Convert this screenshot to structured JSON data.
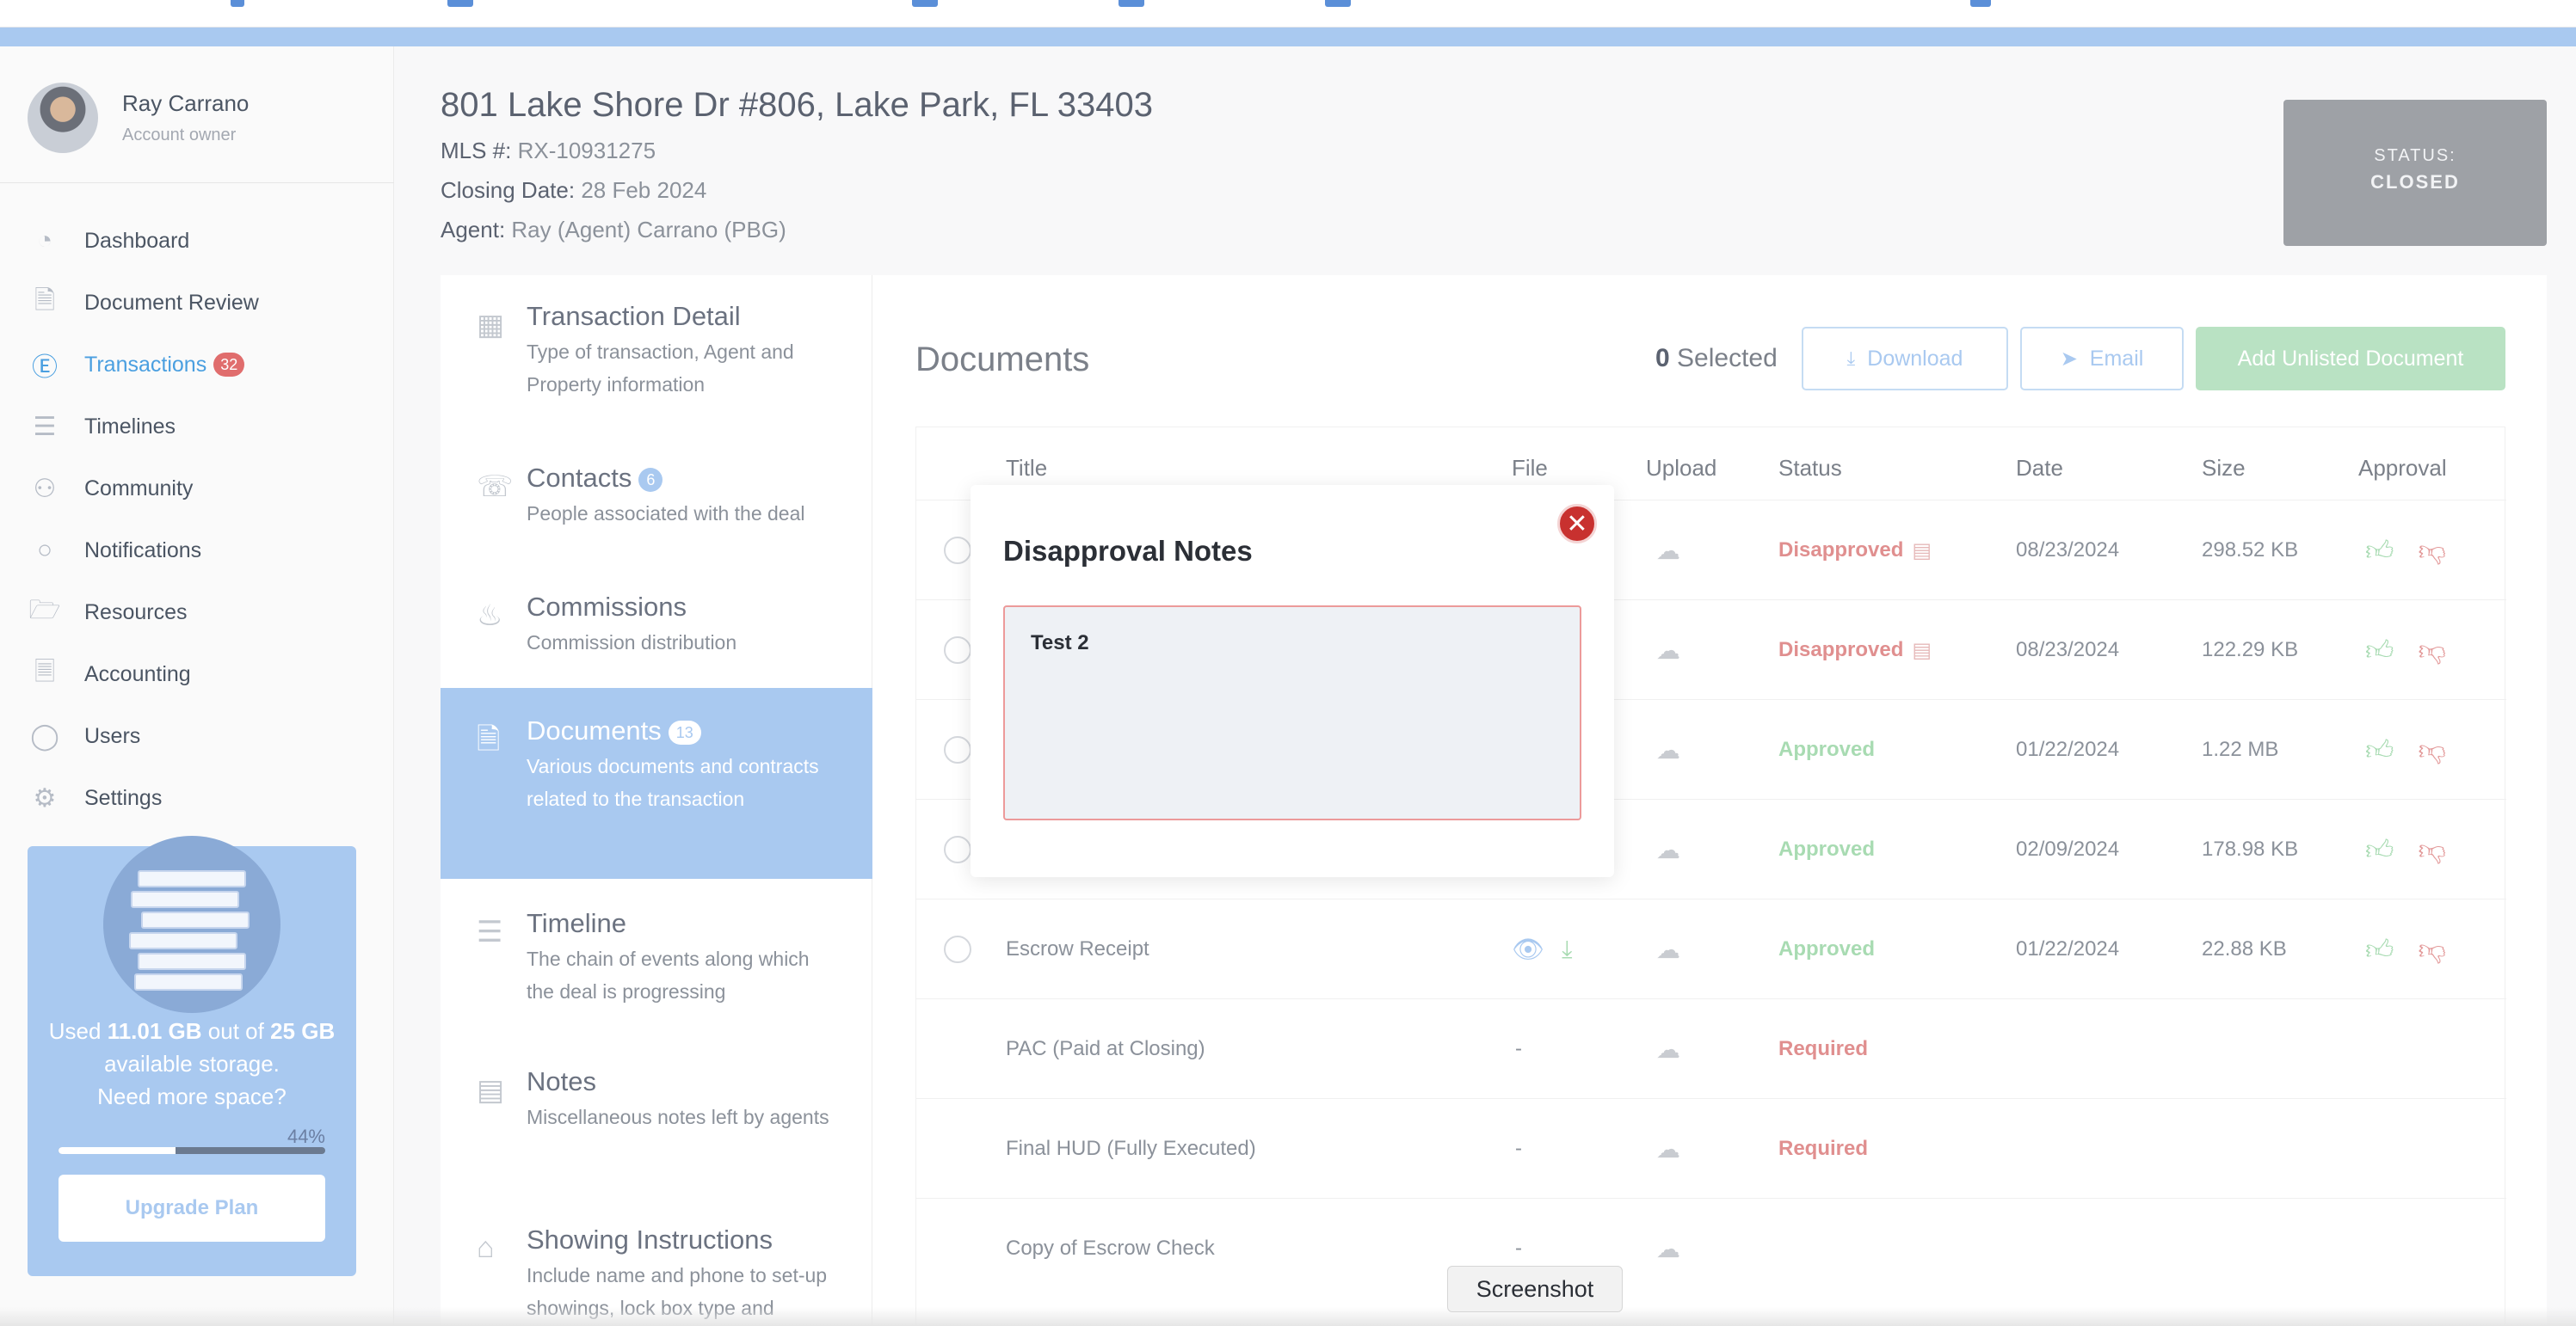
{
  "sidebar": {
    "user": {
      "name": "Ray Carrano",
      "role": "Account owner"
    },
    "nav": [
      {
        "label": "Dashboard",
        "icon": "gauge-icon"
      },
      {
        "label": "Document Review",
        "icon": "document-check-icon"
      },
      {
        "label": "Transactions",
        "icon": "dollar-circle-icon",
        "badge": "32",
        "active": true
      },
      {
        "label": "Timelines",
        "icon": "timeline-icon"
      },
      {
        "label": "Community",
        "icon": "community-icon"
      },
      {
        "label": "Notifications",
        "icon": "chat-bubble-icon"
      },
      {
        "label": "Resources",
        "icon": "folder-icon"
      },
      {
        "label": "Accounting",
        "icon": "accounting-icon"
      },
      {
        "label": "Users",
        "icon": "user-icon"
      },
      {
        "label": "Settings",
        "icon": "gear-icon"
      }
    ],
    "storage": {
      "text_used": "Used",
      "used": "11.01 GB",
      "text_outof": "out of",
      "total": "25 GB",
      "text_available": "available storage.",
      "text_more": "Need more space?",
      "percent_label": "44%",
      "percent": 44,
      "upgrade_label": "Upgrade Plan"
    }
  },
  "header": {
    "address": "801 Lake Shore Dr #806, Lake Park, FL 33403",
    "mls_label": "MLS #:",
    "mls_value": "RX-10931275",
    "closing_label": "Closing Date:",
    "closing_value": "28 Feb 2024",
    "agent_label": "Agent:",
    "agent_value": "Ray (Agent) Carrano (PBG)",
    "status_label": "STATUS:",
    "status_value": "CLOSED"
  },
  "subnav": [
    {
      "title": "Transaction Detail",
      "desc": "Type of transaction, Agent and Property information",
      "icon": "building-icon"
    },
    {
      "title": "Contacts",
      "badge": "6",
      "desc": "People associated with the deal",
      "icon": "phone-icon"
    },
    {
      "title": "Commissions",
      "desc": "Commission distribution",
      "icon": "hand-coin-icon"
    },
    {
      "title": "Documents",
      "badge": "13",
      "desc": "Various documents and contracts related to the transaction",
      "icon": "document-icon",
      "active": true
    },
    {
      "title": "Timeline",
      "desc": "The chain of events along which the deal is progressing",
      "icon": "timeline-icon"
    },
    {
      "title": "Notes",
      "desc": "Miscellaneous notes left by agents",
      "icon": "note-icon"
    },
    {
      "title": "Showing Instructions",
      "desc": "Include name and phone to set-up showings, lock box type and",
      "icon": "house-icon"
    }
  ],
  "documents": {
    "title": "Documents",
    "selected_count": "0",
    "selected_label": "Selected",
    "download_label": "Download",
    "email_label": "Email",
    "add_label": "Add Unlisted Document",
    "columns": [
      "Title",
      "File",
      "Upload",
      "Status",
      "Date",
      "Size",
      "Approval"
    ],
    "rows": [
      {
        "title": "",
        "file": "",
        "status": "Disapproved",
        "status_type": "dis",
        "date": "08/23/2024",
        "size": "298.52 KB",
        "approval": true,
        "radio": true,
        "note": true
      },
      {
        "title": "",
        "file": "",
        "status": "Disapproved",
        "status_type": "dis",
        "date": "08/23/2024",
        "size": "122.29 KB",
        "approval": true,
        "radio": true,
        "note": true
      },
      {
        "title": "",
        "file": "",
        "status": "Approved",
        "status_type": "app",
        "date": "01/22/2024",
        "size": "1.22 MB",
        "approval": true,
        "radio": true
      },
      {
        "title": "",
        "file": "",
        "status": "Approved",
        "status_type": "app",
        "date": "02/09/2024",
        "size": "178.98 KB",
        "approval": true,
        "radio": true
      },
      {
        "title": "Escrow Receipt",
        "file": "icons",
        "status": "Approved",
        "status_type": "app",
        "date": "01/22/2024",
        "size": "22.88 KB",
        "approval": true,
        "radio": true
      },
      {
        "title": "PAC (Paid at Closing)",
        "file": "-",
        "status": "Required",
        "status_type": "req",
        "date": "",
        "size": "",
        "approval": false,
        "radio": false
      },
      {
        "title": "Final HUD (Fully Executed)",
        "file": "-",
        "status": "Required",
        "status_type": "req",
        "date": "",
        "size": "",
        "approval": false,
        "radio": false
      },
      {
        "title": "Copy of Escrow Check",
        "file": "-",
        "status": "",
        "status_type": "",
        "date": "",
        "size": "",
        "approval": false,
        "radio": false
      }
    ]
  },
  "modal": {
    "title": "Disapproval Notes",
    "note": "Test 2"
  },
  "tooltip": "Screenshot"
}
